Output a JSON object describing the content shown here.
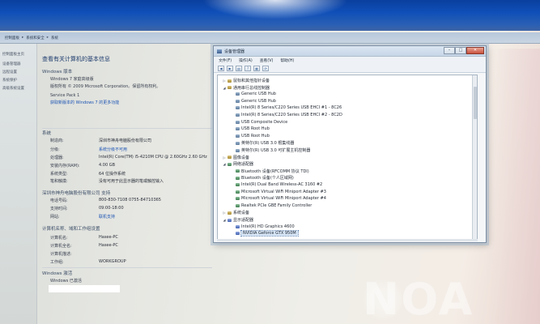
{
  "address_bar": {
    "crumbs": [
      "控制面板",
      "系统和安全",
      "系统"
    ]
  },
  "left_pane": {
    "items": [
      "控制面板主页",
      "设备管理器",
      "远程设置",
      "系统保护",
      "高级系统设置"
    ]
  },
  "system": {
    "page_title": "查看有关计算机的基本信息",
    "edition_header": "Windows 版本",
    "edition_name": "Windows 7 家庭高级版",
    "copyright": "版权所有 © 2009 Microsoft Corporation。保留所有权利。",
    "service_pack": "Service Pack 1",
    "upgrade_link": "获取新版本的 Windows 7 的更多功能",
    "system_header": "系统",
    "rows": [
      {
        "label": "制造商:",
        "value": "深圳市神舟电脑股份有限公司"
      },
      {
        "label": "分级:",
        "value": "系统分级不可用"
      },
      {
        "label": "处理器:",
        "value": "Intel(R) Core(TM) i5-4210M CPU @ 2.60GHz   2.60 GHz"
      },
      {
        "label": "安装内存(RAM):",
        "value": "4.00 GB"
      },
      {
        "label": "系统类型:",
        "value": "64 位操作系统"
      },
      {
        "label": "笔和触摸:",
        "value": "没有可用于此显示器的笔或触控输入"
      }
    ],
    "support_header": "深圳市神舟电脑股份有限公司 支持",
    "support_rows": [
      {
        "label": "电话号码:",
        "value": "800-830-7108 0755-84710365"
      },
      {
        "label": "支持时间:",
        "value": "09:00-18:00"
      },
      {
        "label": "网站:",
        "value": "联机支持"
      }
    ],
    "computer_header": "计算机名称、域和工作组设置",
    "computer_rows": [
      {
        "label": "计算机名:",
        "value": "Hasee-PC"
      },
      {
        "label": "计算机全名:",
        "value": "Hasee-PC"
      },
      {
        "label": "计算机描述:",
        "value": ""
      },
      {
        "label": "工作组:",
        "value": "WORKGROUP"
      }
    ],
    "activation_header": "Windows 激活",
    "activation_status": "Windows 已激活"
  },
  "device_manager": {
    "title": "设备管理器",
    "menus": [
      "文件(F)",
      "操作(A)",
      "查看(V)",
      "帮助(H)"
    ],
    "toolbar_icons": [
      "back-icon",
      "forward-icon",
      "properties-icon",
      "help-icon",
      "scan-icon",
      "update-icon"
    ],
    "tree": [
      {
        "text": "鼠标和其他指针设备",
        "level": 0,
        "exp": "▷",
        "icon": "cat"
      },
      {
        "text": "通用串行总线控制器",
        "level": 0,
        "exp": "◢",
        "icon": "cat"
      },
      {
        "text": "Generic USB Hub",
        "level": 1,
        "exp": "",
        "icon": "dev"
      },
      {
        "text": "Generic USB Hub",
        "level": 1,
        "exp": "",
        "icon": "dev"
      },
      {
        "text": "Intel(R) 8 Series/C220 Series USB EHCI #1 - 8C26",
        "level": 1,
        "exp": "",
        "icon": "dev"
      },
      {
        "text": "Intel(R) 8 Series/C220 Series USB EHCI #2 - 8C2D",
        "level": 1,
        "exp": "",
        "icon": "dev"
      },
      {
        "text": "USB Composite Device",
        "level": 1,
        "exp": "",
        "icon": "dev"
      },
      {
        "text": "USB Root Hub",
        "level": 1,
        "exp": "",
        "icon": "dev"
      },
      {
        "text": "USB Root Hub",
        "level": 1,
        "exp": "",
        "icon": "dev"
      },
      {
        "text": "英特尔(R) USB 3.0 根集线器",
        "level": 1,
        "exp": "",
        "icon": "dev"
      },
      {
        "text": "英特尔(R) USB 3.0 可扩展主机控制器",
        "level": 1,
        "exp": "",
        "icon": "dev"
      },
      {
        "text": "图像设备",
        "level": 0,
        "exp": "▷",
        "icon": "cat"
      },
      {
        "text": "网络适配器",
        "level": 0,
        "exp": "◢",
        "icon": "net"
      },
      {
        "text": "Bluetooth 设备(RFCOMM 协议 TDI)",
        "level": 1,
        "exp": "",
        "icon": "net"
      },
      {
        "text": "Bluetooth 设备(个人区域网)",
        "level": 1,
        "exp": "",
        "icon": "net"
      },
      {
        "text": "Intel(R) Dual Band Wireless-AC 3160 #2",
        "level": 1,
        "exp": "",
        "icon": "net"
      },
      {
        "text": "Microsoft Virtual WiFi Miniport Adapter #3",
        "level": 1,
        "exp": "",
        "icon": "net"
      },
      {
        "text": "Microsoft Virtual WiFi Miniport Adapter #4",
        "level": 1,
        "exp": "",
        "icon": "net"
      },
      {
        "text": "Realtek PCIe GBE Family Controller",
        "level": 1,
        "exp": "",
        "icon": "net"
      },
      {
        "text": "系统设备",
        "level": 0,
        "exp": "▷",
        "icon": "cat"
      },
      {
        "text": "显示适配器",
        "level": 0,
        "exp": "◢",
        "icon": "disp"
      },
      {
        "text": "Intel(R) HD Graphics 4600",
        "level": 1,
        "exp": "",
        "icon": "disp"
      },
      {
        "text": "NVIDIA Geforce GTX 950M",
        "level": 1,
        "exp": "",
        "icon": "disp",
        "selected": true
      }
    ]
  },
  "watermark": "NOA"
}
